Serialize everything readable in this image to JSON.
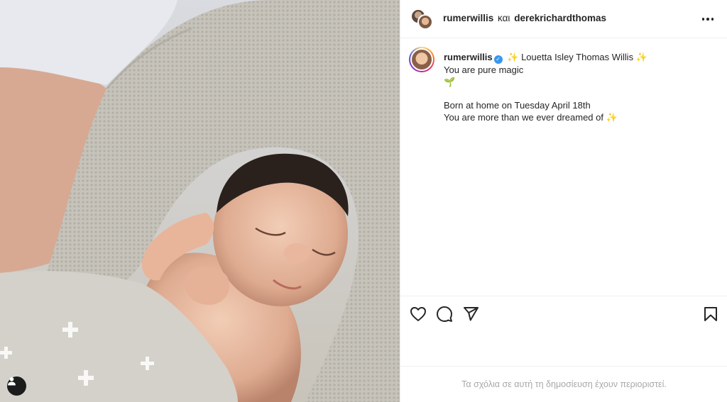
{
  "post": {
    "header": {
      "user_primary": "rumerwillis",
      "conjunction": "και",
      "user_secondary": "derekrichardthomas"
    },
    "caption": {
      "username": "rumerwillis",
      "verified_mark": "✓",
      "emoji_sparkle": "✨",
      "emoji_sprout": "🌱",
      "title": "Louetta Isley Thomas Willis",
      "line_magic": "You are pure magic",
      "line_born": "Born at home on Tuesday April 18th",
      "line_dream": "You are more than we ever dreamed of"
    },
    "comments_restricted": "Τα σχόλια σε αυτή τη δημοσίευση έχουν περιοριστεί."
  },
  "icons": {
    "like": "heart-icon",
    "comment": "comment-icon",
    "share": "send-icon",
    "save": "bookmark-icon",
    "more": "more-icon",
    "tagged_user": "user-icon"
  },
  "colors": {
    "text": "#262626",
    "muted": "#a8a8a8",
    "divider": "#efefef",
    "verified": "#3897f0"
  }
}
